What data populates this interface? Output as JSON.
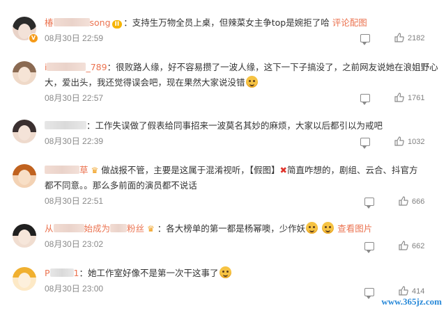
{
  "comments": [
    {
      "name_prefix": "椿",
      "name_suffix": "song",
      "level_badge": "II",
      "text": "：支持生万物全员上桌，但辣菜女主争top是婉拒了哈",
      "link": "评论配图",
      "time": "08月30日 22:59",
      "likes": "2182",
      "avatar_colors": [
        "#2b2b2b",
        "#e9d3c8"
      ]
    },
    {
      "name_prefix": "i",
      "name_suffix": "_789",
      "text": "：很败路人缘，好不容易攒了一波人缘，这下一下子搞没了，之前网友说她在浪姐野心",
      "text2": "大，爱出头，我还觉得误会吧，现在果然大家说没错",
      "time": "08月30日 22:57",
      "likes": "1761",
      "avatar_colors": [
        "#8a6a52",
        "#efd9c8"
      ]
    },
    {
      "text": "：工作失误做了假表给同事招来一波莫名其妙的麻烦，大家以后都引以为戒吧",
      "time": "08月30日 22:39",
      "likes": "1032",
      "avatar_colors": [
        "#3a3030",
        "#eedacd"
      ]
    },
    {
      "name_suffix": "草",
      "text_a": "做战报不管，主要是这属于混淆视听，【假图】",
      "text_b": "简直咋想的，剧组、云合、抖官方",
      "text2": "都不同意。。那么多前面的演员都不说话",
      "time": "08月30日 22:51",
      "likes": "666",
      "avatar_colors": [
        "#c0621f",
        "#f3d2b4"
      ]
    },
    {
      "name_prefix": "从",
      "name_mid": "始成为",
      "name_suffix": "粉丝",
      "text": "：各大榜单的第一都是杨幂噢，少作妖",
      "link": "查看图片",
      "time": "08月30日 23:02",
      "likes": "662",
      "avatar_colors": [
        "#202020",
        "#f0ddd0"
      ]
    },
    {
      "name_prefix": "P",
      "name_suffix": "1",
      "text": "：她工作室好像不是第一次干这事了",
      "time": "08月30日 23:00",
      "likes": "414",
      "avatar_colors": [
        "#f0b030",
        "#fde9c6"
      ]
    }
  ],
  "watermark": "www.365jz.com"
}
